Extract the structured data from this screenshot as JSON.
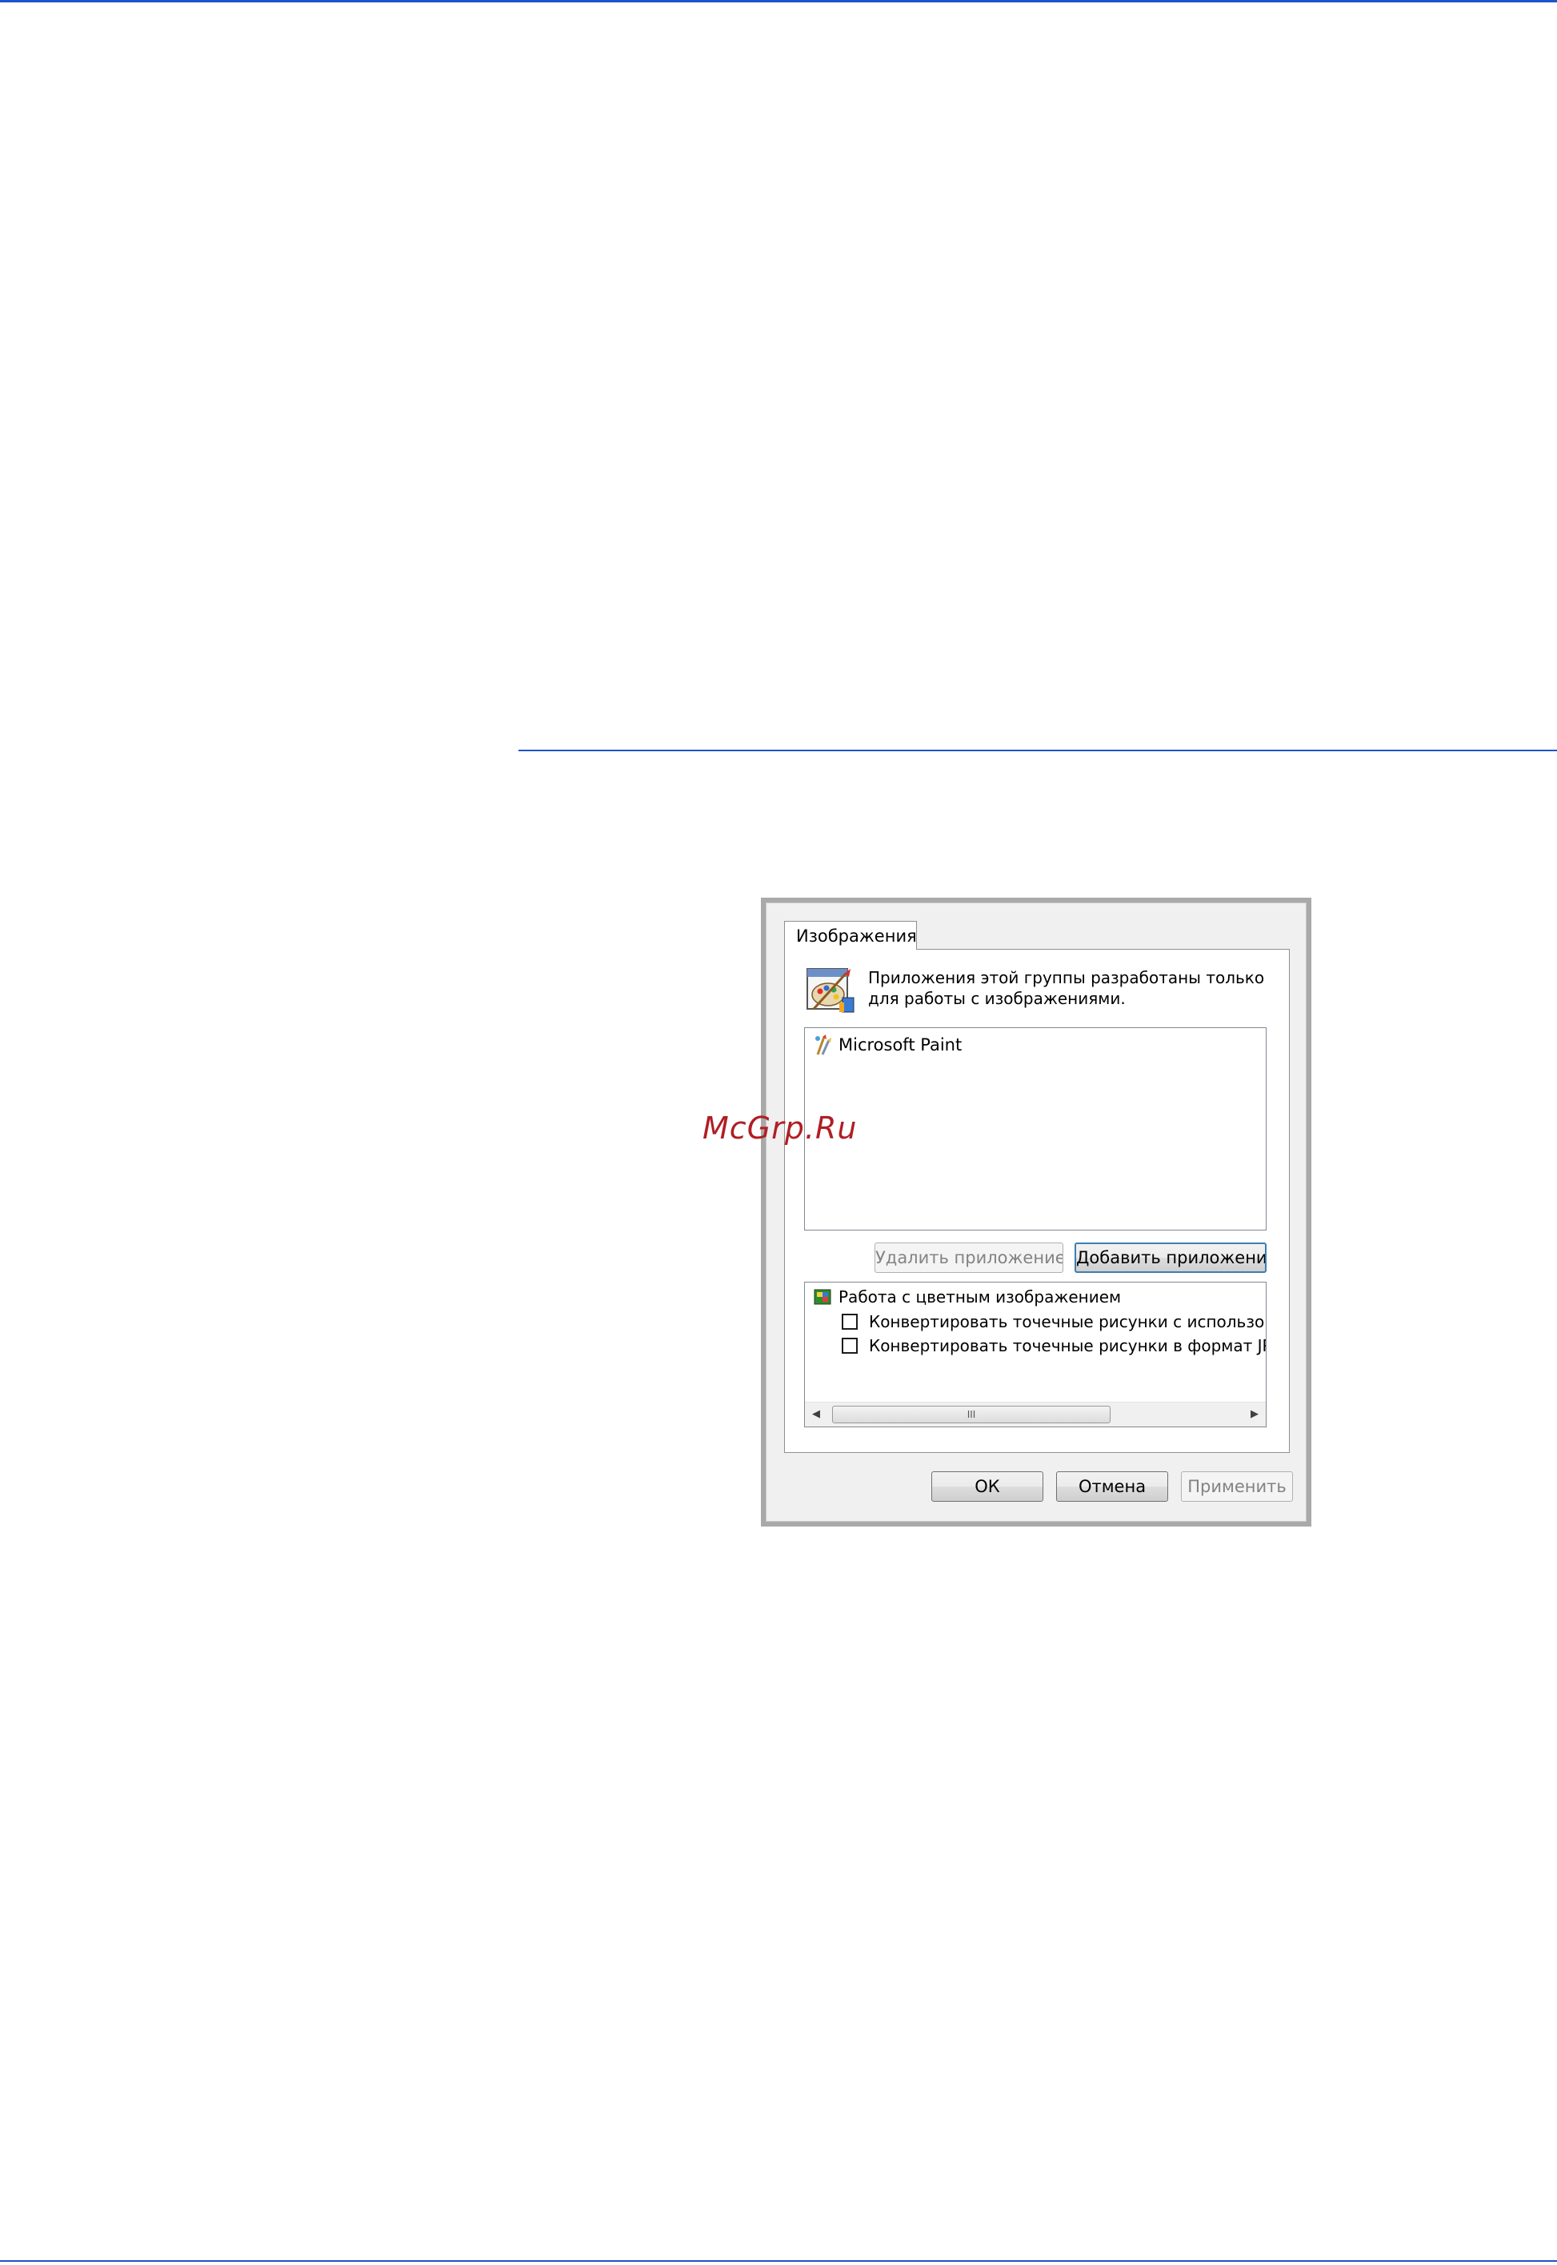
{
  "watermark": "McGrp.Ru",
  "dialog": {
    "tab_label": "Изображения",
    "header_text": "Приложения этой группы разработаны только для работы с изображениями.",
    "header_icon": "paint-palette-icon",
    "apps": [
      {
        "name": "Microsoft Paint",
        "icon": "paint-brush-icon"
      }
    ],
    "remove_app_label": "Удалить приложение",
    "add_app_label": "Добавить приложение",
    "options": {
      "group_label": "Работа с цветным изображением",
      "group_icon": "color-image-icon",
      "items": [
        {
          "label": "Конвертировать точечные рисунки с использован",
          "checked": false
        },
        {
          "label": "Конвертировать точечные рисунки в формат JPEG",
          "checked": false
        }
      ],
      "scroll_thumb_label": "III"
    },
    "ok_label": "ОК",
    "cancel_label": "Отмена",
    "apply_label": "Применить"
  }
}
